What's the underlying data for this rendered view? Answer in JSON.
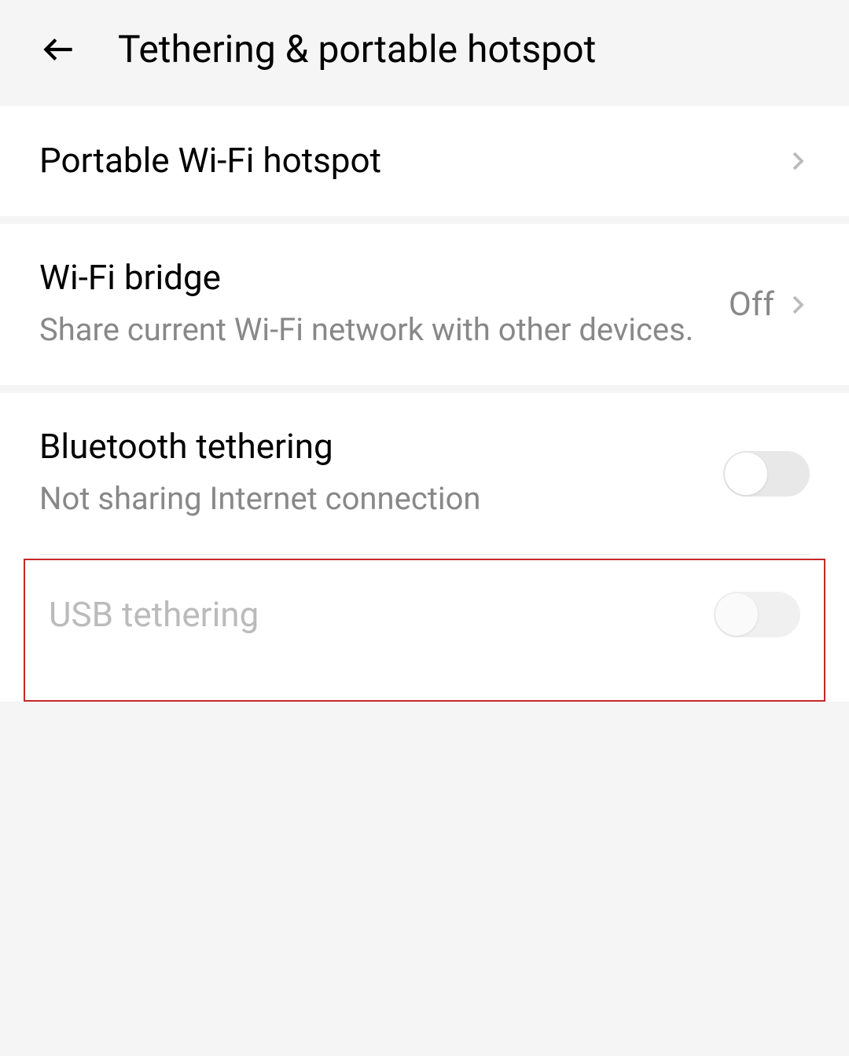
{
  "header": {
    "title": "Tethering & portable hotspot"
  },
  "items": {
    "portable_hotspot": {
      "title": "Portable Wi-Fi hotspot"
    },
    "wifi_bridge": {
      "title": "Wi-Fi bridge",
      "subtitle": "Share current Wi-Fi network with other devices.",
      "value": "Off"
    },
    "bluetooth_tethering": {
      "title": "Bluetooth tethering",
      "subtitle": "Not sharing Internet connection"
    },
    "usb_tethering": {
      "title": "USB tethering"
    }
  }
}
